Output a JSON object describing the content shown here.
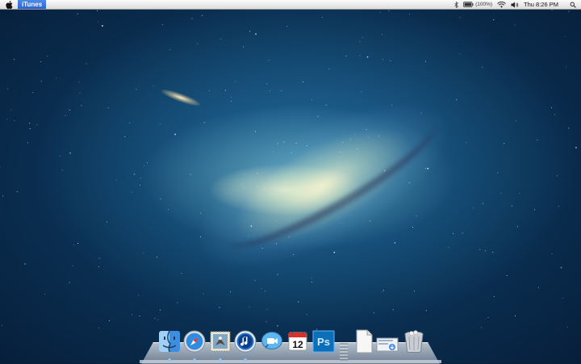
{
  "menubar": {
    "apple_icon": "apple-logo-icon",
    "app_name": "iTunes",
    "battery_text": "(100%)",
    "clock": "Thu 8:26 PM",
    "status_icons": [
      "bluetooth-icon",
      "battery-icon",
      "wifi-icon",
      "volume-icon",
      "spotlight-search-icon"
    ]
  },
  "dock": {
    "items": [
      {
        "name": "finder",
        "icon": "finder-icon",
        "running": true
      },
      {
        "name": "safari",
        "icon": "safari-compass-icon",
        "running": true
      },
      {
        "name": "mail",
        "icon": "mail-stamp-eagle-icon",
        "running": true
      },
      {
        "name": "itunes",
        "icon": "itunes-music-note-icon",
        "running": true
      },
      {
        "name": "facetime",
        "icon": "facetime-camera-icon",
        "running": false
      },
      {
        "name": "calendar",
        "icon": "calendar-icon",
        "date": "12",
        "running": false
      },
      {
        "name": "photoshop",
        "icon": "photoshop-icon",
        "label": "Ps",
        "running": false
      },
      {
        "name": "document",
        "icon": "blank-document-icon",
        "running": false
      },
      {
        "name": "downloads",
        "icon": "downloads-stack-icon",
        "running": false
      },
      {
        "name": "trash",
        "icon": "trash-full-icon",
        "running": false
      }
    ]
  },
  "colors": {
    "menubar_highlight": "#2a64d6",
    "photoshop_blue": "#0d6fb8",
    "desktop_deep": "#07203d"
  }
}
